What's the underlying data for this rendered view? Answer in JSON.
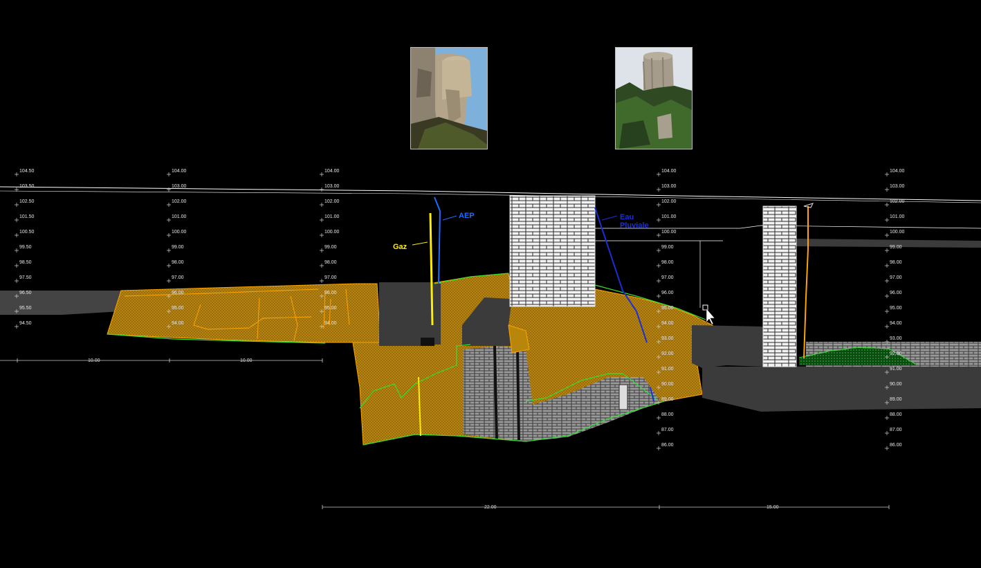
{
  "colors": {
    "background": "#000000",
    "soil_fill": "#b8860b",
    "soil_outline": "#ffa500",
    "ground_line": "#33dd33",
    "masonry": "#8a8a8a",
    "rock_dark": "#3b3b3b",
    "gas_pipe": "#ffee00",
    "water_pipe": "#1e6bff",
    "rain_pipe": "#1a2fd6",
    "surface_line": "#ffffff"
  },
  "photos": [
    {
      "name": "tower-photo-left",
      "icon": "castle-tower-photo"
    },
    {
      "name": "tower-photo-right",
      "icon": "castle-tower-photo"
    }
  ],
  "networks": {
    "gas": "Gaz",
    "water": "AEP",
    "rain_line1": "Eau",
    "rain_line2": "Pluviale"
  },
  "elevation_scales": [
    {
      "values": [
        "104.50",
        "103.50",
        "102.50",
        "101.50",
        "100.50",
        "99.50",
        "98.50",
        "97.50",
        "96.50",
        "95.50",
        "94.50"
      ]
    },
    {
      "values": [
        "104.00",
        "103.00",
        "102.00",
        "101.00",
        "100.00",
        "99.00",
        "98.00",
        "97.00",
        "96.00",
        "95.00",
        "94.00"
      ]
    },
    {
      "values": [
        "104.00",
        "103.00",
        "102.00",
        "101.00",
        "100.00",
        "99.00",
        "98.00",
        "97.00",
        "96.00",
        "95.00",
        "94.00"
      ]
    },
    {
      "values": [
        "104.00",
        "103.00",
        "102.00",
        "101.00",
        "100.00",
        "99.00",
        "98.00",
        "97.00",
        "96.00",
        "95.00",
        "94.00",
        "93.00",
        "92.00",
        "91.00",
        "90.00",
        "89.00",
        "88.00",
        "87.00",
        "86.00"
      ]
    },
    {
      "values": [
        "104.00",
        "103.00",
        "102.00",
        "101.00",
        "100.00",
        "99.00",
        "98.00",
        "97.00",
        "96.00",
        "95.00",
        "94.00",
        "93.00",
        "92.00",
        "91.00",
        "90.00",
        "89.00",
        "88.00",
        "87.00",
        "86.00"
      ]
    }
  ],
  "dimensions": {
    "upper_left": "10.00",
    "upper_right": "10.00",
    "lower_left": "22.00",
    "lower_right": "15.00"
  }
}
